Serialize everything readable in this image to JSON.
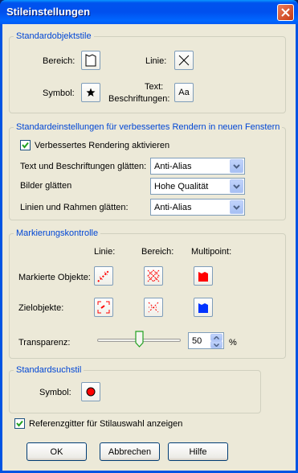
{
  "window": {
    "title": "Stileinstellungen"
  },
  "standard_styles": {
    "legend": "Standardobjektstile",
    "area_label": "Bereich:",
    "line_label": "Linie:",
    "symbol_label": "Symbol:",
    "text_label_1": "Text:",
    "text_label_2": "Beschriftungen:",
    "text_button": "Aa"
  },
  "render": {
    "legend": "Standardeinstellungen für verbessertes Rendern in neuen Fenstern",
    "enable_label": "Verbessertes Rendering aktivieren",
    "enable_checked": true,
    "text_smooth_label": "Text und Beschriftungen glätten:",
    "text_smooth_value": "Anti-Alias",
    "image_smooth_label": "Bilder glätten",
    "image_smooth_value": "Hohe Qualität",
    "lines_smooth_label": "Linien und Rahmen glätten:",
    "lines_smooth_value": "Anti-Alias"
  },
  "markers": {
    "legend": "Markierungskontrolle",
    "col_line": "Linie:",
    "col_area": "Bereich:",
    "col_multipoint": "Multipoint:",
    "marked_label": "Markierte Objekte:",
    "target_label": "Zielobjekte:",
    "transparency_label": "Transparenz:",
    "transparency_value": "50",
    "transparency_unit": "%",
    "slider_fraction": 0.5,
    "marked_color": "#ff0000",
    "target_color": "#0033ff"
  },
  "search": {
    "legend": "Standardsuchstil",
    "symbol_label": "Symbol:"
  },
  "grid": {
    "label": "Referenzgitter für Stilauswahl anzeigen",
    "checked": true
  },
  "buttons": {
    "ok": "OK",
    "cancel": "Abbrechen",
    "help": "Hilfe"
  }
}
